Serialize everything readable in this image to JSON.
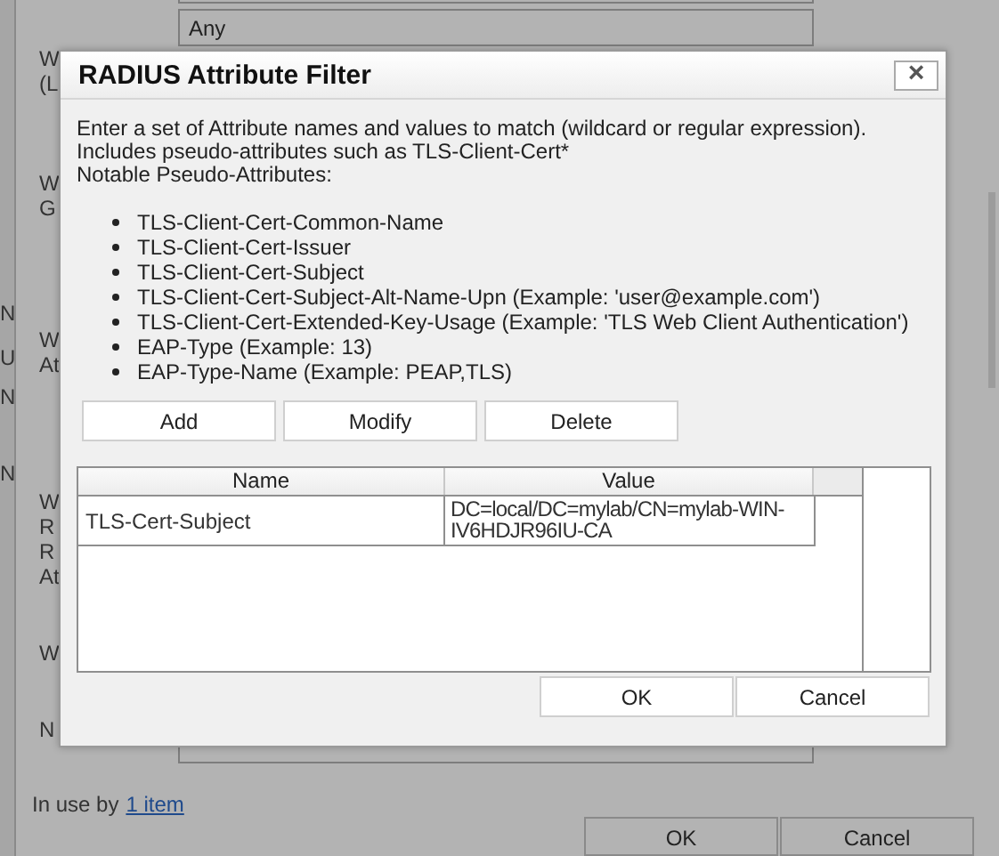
{
  "background": {
    "strip_labels": [
      "N",
      "U",
      "N",
      "N"
    ],
    "labels": [
      "W",
      "(L",
      "W",
      "G",
      "W",
      "At",
      "W",
      "R",
      "R",
      "At",
      "W",
      "N"
    ],
    "fields": [
      {
        "kind": "blank"
      },
      {
        "kind": "text",
        "value": "Any"
      },
      {
        "kind": "blank"
      }
    ],
    "usage": {
      "text": "In use by",
      "link": "1 item"
    },
    "buttons": [
      "OK",
      "Cancel"
    ]
  },
  "dialog": {
    "title": "RADIUS Attribute Filter",
    "close": "×",
    "intro": [
      "Enter a set of Attribute names and values to match (wildcard or regular expression).",
      "Includes pseudo-attributes such as TLS-Client-Cert*",
      "Notable Pseudo-Attributes:"
    ],
    "attributes": [
      "TLS-Client-Cert-Common-Name",
      "TLS-Client-Cert-Issuer",
      "TLS-Client-Cert-Subject",
      "TLS-Client-Cert-Subject-Alt-Name-Upn (Example: 'user@example.com')",
      "TLS-Client-Cert-Extended-Key-Usage (Example: 'TLS Web Client Authentication')",
      "EAP-Type (Example: 13)",
      "EAP-Type-Name (Example: PEAP,TLS)"
    ],
    "actions": [
      "Add",
      "Modify",
      "Delete"
    ],
    "table": {
      "columns": [
        "Name",
        "Value"
      ],
      "rows": [
        {
          "cells": [
            "TLS-Cert-Subject",
            "DC=local/DC=mylab/CN=mylab-WIN-IV6HDJR96IU-CA"
          ]
        }
      ]
    },
    "buttons": [
      "OK",
      "Cancel"
    ]
  }
}
